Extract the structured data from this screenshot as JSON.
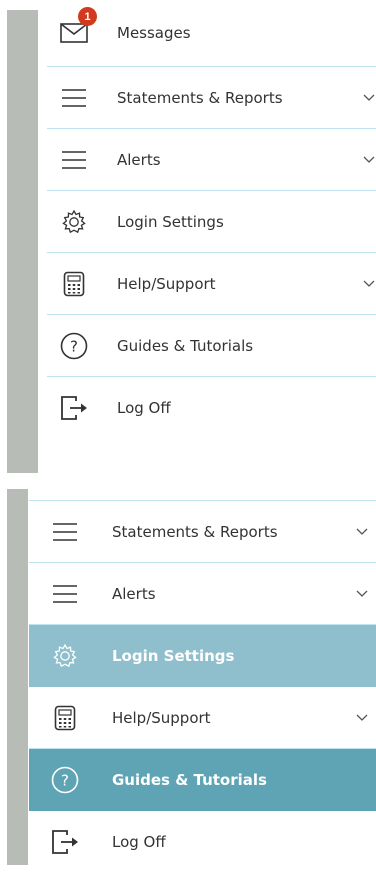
{
  "top_menu": {
    "items": [
      {
        "label": "Messages",
        "icon": "mail-icon",
        "badge": "1",
        "has_chevron": false
      },
      {
        "label": "Statements & Reports",
        "icon": "menu-lines-icon",
        "has_chevron": true
      },
      {
        "label": "Alerts",
        "icon": "menu-lines-icon",
        "has_chevron": true
      },
      {
        "label": "Login Settings",
        "icon": "gear-icon",
        "has_chevron": false
      },
      {
        "label": "Help/Support",
        "icon": "calculator-icon",
        "has_chevron": true
      },
      {
        "label": "Guides & Tutorials",
        "icon": "question-circle-icon",
        "has_chevron": false
      },
      {
        "label": "Log Off",
        "icon": "logout-icon",
        "has_chevron": false
      }
    ]
  },
  "bottom_menu": {
    "items": [
      {
        "label": "Statements & Reports",
        "icon": "menu-lines-icon",
        "has_chevron": true,
        "state": "normal"
      },
      {
        "label": "Alerts",
        "icon": "menu-lines-icon",
        "has_chevron": true,
        "state": "normal"
      },
      {
        "label": "Login Settings",
        "icon": "gear-icon",
        "has_chevron": false,
        "state": "hover"
      },
      {
        "label": "Help/Support",
        "icon": "calculator-icon",
        "has_chevron": true,
        "state": "normal"
      },
      {
        "label": "Guides & Tutorials",
        "icon": "question-circle-icon",
        "has_chevron": false,
        "state": "active"
      },
      {
        "label": "Log Off",
        "icon": "logout-icon",
        "has_chevron": false,
        "state": "normal"
      }
    ]
  },
  "colors": {
    "divider": "#bfe3ee",
    "hover_bg": "#8fbfcc",
    "active_bg": "#5fa4b4",
    "badge": "#d23a1f",
    "side_strip": "#b7bcb7"
  }
}
